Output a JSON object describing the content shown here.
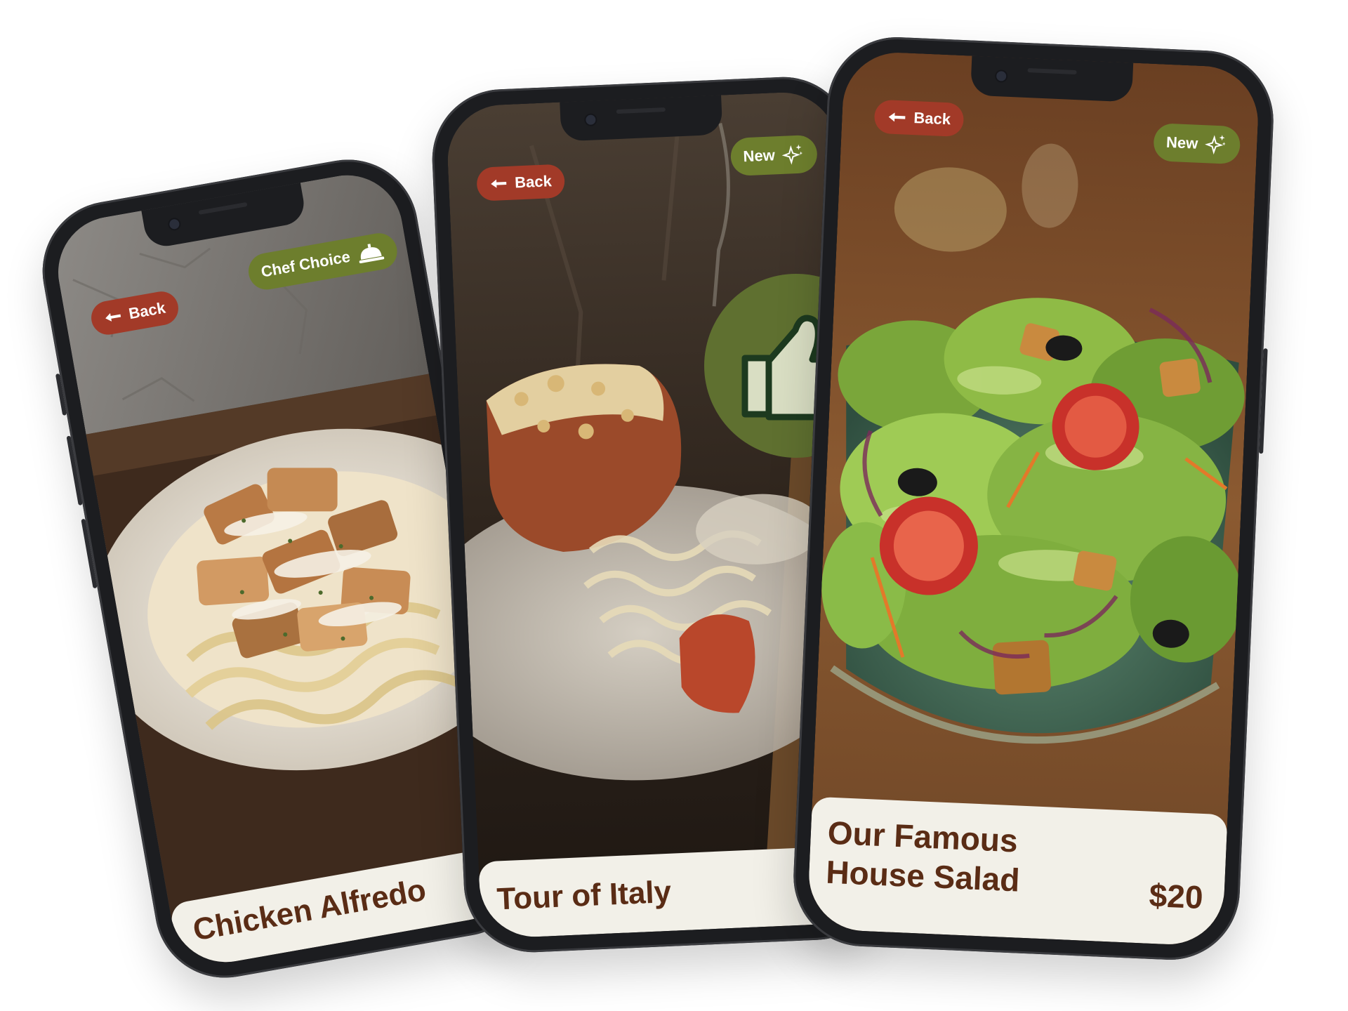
{
  "phones": [
    {
      "back_label": "Back",
      "badge_label": "Chef Choice",
      "badge_icon": "service-bell-icon",
      "title": "Chicken Alfredo"
    },
    {
      "back_label": "Back",
      "badge_label": "New",
      "badge_icon": "sparkles-icon",
      "title": "Tour of Italy"
    },
    {
      "back_label": "Back",
      "badge_label": "New",
      "badge_icon": "sparkles-icon",
      "title_line1": "Our Famous",
      "title_line2": "House Salad",
      "price": "$20"
    }
  ],
  "like_icon": "thumbs-up-icon",
  "colors": {
    "back_pill": "#a23a28",
    "badge_pill": "#6d7e2d",
    "like_circle": "#5f7030",
    "title_text": "#5a2c15",
    "title_card": "#f2f0e8",
    "phone_frame": "#1c1d20"
  }
}
